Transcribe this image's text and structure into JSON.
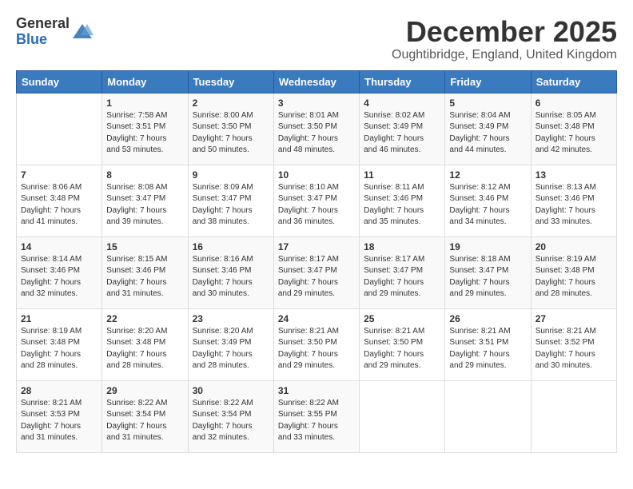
{
  "logo": {
    "general": "General",
    "blue": "Blue"
  },
  "title": "December 2025",
  "location": "Oughtibridge, England, United Kingdom",
  "days_of_week": [
    "Sunday",
    "Monday",
    "Tuesday",
    "Wednesday",
    "Thursday",
    "Friday",
    "Saturday"
  ],
  "weeks": [
    [
      {
        "day": "",
        "info": ""
      },
      {
        "day": "1",
        "info": "Sunrise: 7:58 AM\nSunset: 3:51 PM\nDaylight: 7 hours\nand 53 minutes."
      },
      {
        "day": "2",
        "info": "Sunrise: 8:00 AM\nSunset: 3:50 PM\nDaylight: 7 hours\nand 50 minutes."
      },
      {
        "day": "3",
        "info": "Sunrise: 8:01 AM\nSunset: 3:50 PM\nDaylight: 7 hours\nand 48 minutes."
      },
      {
        "day": "4",
        "info": "Sunrise: 8:02 AM\nSunset: 3:49 PM\nDaylight: 7 hours\nand 46 minutes."
      },
      {
        "day": "5",
        "info": "Sunrise: 8:04 AM\nSunset: 3:49 PM\nDaylight: 7 hours\nand 44 minutes."
      },
      {
        "day": "6",
        "info": "Sunrise: 8:05 AM\nSunset: 3:48 PM\nDaylight: 7 hours\nand 42 minutes."
      }
    ],
    [
      {
        "day": "7",
        "info": "Sunrise: 8:06 AM\nSunset: 3:48 PM\nDaylight: 7 hours\nand 41 minutes."
      },
      {
        "day": "8",
        "info": "Sunrise: 8:08 AM\nSunset: 3:47 PM\nDaylight: 7 hours\nand 39 minutes."
      },
      {
        "day": "9",
        "info": "Sunrise: 8:09 AM\nSunset: 3:47 PM\nDaylight: 7 hours\nand 38 minutes."
      },
      {
        "day": "10",
        "info": "Sunrise: 8:10 AM\nSunset: 3:47 PM\nDaylight: 7 hours\nand 36 minutes."
      },
      {
        "day": "11",
        "info": "Sunrise: 8:11 AM\nSunset: 3:46 PM\nDaylight: 7 hours\nand 35 minutes."
      },
      {
        "day": "12",
        "info": "Sunrise: 8:12 AM\nSunset: 3:46 PM\nDaylight: 7 hours\nand 34 minutes."
      },
      {
        "day": "13",
        "info": "Sunrise: 8:13 AM\nSunset: 3:46 PM\nDaylight: 7 hours\nand 33 minutes."
      }
    ],
    [
      {
        "day": "14",
        "info": "Sunrise: 8:14 AM\nSunset: 3:46 PM\nDaylight: 7 hours\nand 32 minutes."
      },
      {
        "day": "15",
        "info": "Sunrise: 8:15 AM\nSunset: 3:46 PM\nDaylight: 7 hours\nand 31 minutes."
      },
      {
        "day": "16",
        "info": "Sunrise: 8:16 AM\nSunset: 3:46 PM\nDaylight: 7 hours\nand 30 minutes."
      },
      {
        "day": "17",
        "info": "Sunrise: 8:17 AM\nSunset: 3:47 PM\nDaylight: 7 hours\nand 29 minutes."
      },
      {
        "day": "18",
        "info": "Sunrise: 8:17 AM\nSunset: 3:47 PM\nDaylight: 7 hours\nand 29 minutes."
      },
      {
        "day": "19",
        "info": "Sunrise: 8:18 AM\nSunset: 3:47 PM\nDaylight: 7 hours\nand 29 minutes."
      },
      {
        "day": "20",
        "info": "Sunrise: 8:19 AM\nSunset: 3:48 PM\nDaylight: 7 hours\nand 28 minutes."
      }
    ],
    [
      {
        "day": "21",
        "info": "Sunrise: 8:19 AM\nSunset: 3:48 PM\nDaylight: 7 hours\nand 28 minutes."
      },
      {
        "day": "22",
        "info": "Sunrise: 8:20 AM\nSunset: 3:48 PM\nDaylight: 7 hours\nand 28 minutes."
      },
      {
        "day": "23",
        "info": "Sunrise: 8:20 AM\nSunset: 3:49 PM\nDaylight: 7 hours\nand 28 minutes."
      },
      {
        "day": "24",
        "info": "Sunrise: 8:21 AM\nSunset: 3:50 PM\nDaylight: 7 hours\nand 29 minutes."
      },
      {
        "day": "25",
        "info": "Sunrise: 8:21 AM\nSunset: 3:50 PM\nDaylight: 7 hours\nand 29 minutes."
      },
      {
        "day": "26",
        "info": "Sunrise: 8:21 AM\nSunset: 3:51 PM\nDaylight: 7 hours\nand 29 minutes."
      },
      {
        "day": "27",
        "info": "Sunrise: 8:21 AM\nSunset: 3:52 PM\nDaylight: 7 hours\nand 30 minutes."
      }
    ],
    [
      {
        "day": "28",
        "info": "Sunrise: 8:21 AM\nSunset: 3:53 PM\nDaylight: 7 hours\nand 31 minutes."
      },
      {
        "day": "29",
        "info": "Sunrise: 8:22 AM\nSunset: 3:54 PM\nDaylight: 7 hours\nand 31 minutes."
      },
      {
        "day": "30",
        "info": "Sunrise: 8:22 AM\nSunset: 3:54 PM\nDaylight: 7 hours\nand 32 minutes."
      },
      {
        "day": "31",
        "info": "Sunrise: 8:22 AM\nSunset: 3:55 PM\nDaylight: 7 hours\nand 33 minutes."
      },
      {
        "day": "",
        "info": ""
      },
      {
        "day": "",
        "info": ""
      },
      {
        "day": "",
        "info": ""
      }
    ]
  ]
}
